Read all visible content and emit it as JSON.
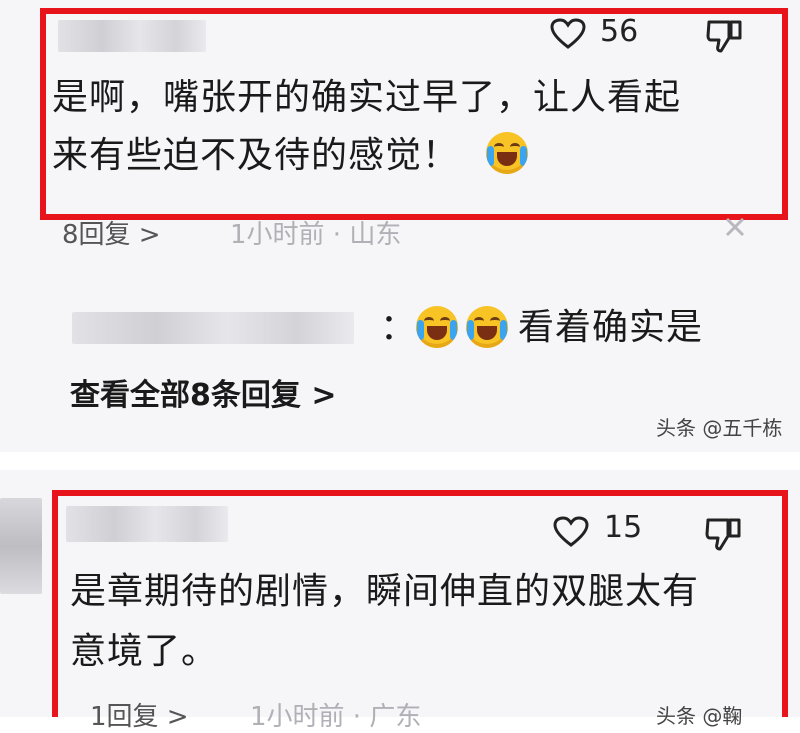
{
  "comment1": {
    "likes": "56",
    "text_line1": "是啊，嘴张开的确实过早了，让人看起",
    "text_line2": "来有些迫不及待的感觉！",
    "replies_label": "8回复 >",
    "time_location": "1小时前 · 山东",
    "reply_preview_text": "：",
    "reply_preview_tail": "看着确实是",
    "view_all": "查看全部8条回复 >"
  },
  "watermark1": "头条 @五千栋",
  "comment2": {
    "likes": "15",
    "text_line1": "是章期待的剧情，瞬间伸直的双腿太有",
    "text_line2": "意境了。",
    "replies_label": "1回复 >",
    "time_location": "1小时前 · 广东"
  },
  "watermark2": "头条 @鞠",
  "colors": {
    "highlight_border": "#e8141c",
    "card_bg": "#f6f6f8"
  },
  "icons": [
    "heart-icon",
    "dislike-icon",
    "close-icon",
    "crying-laughing-emoji"
  ]
}
